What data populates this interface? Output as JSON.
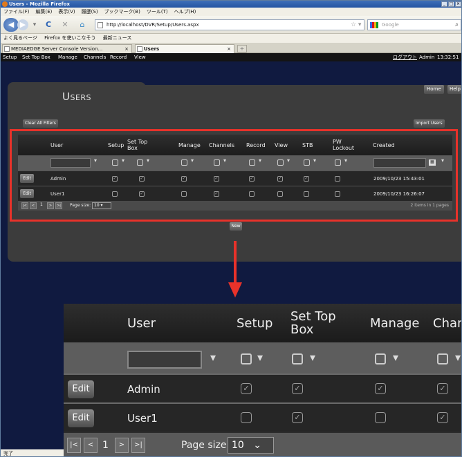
{
  "window": {
    "title": "Users - Mozilla Firefox",
    "controls": [
      "_",
      "□",
      "×"
    ]
  },
  "menu": [
    "ファイル(F)",
    "編集(E)",
    "表示(V)",
    "履歴(S)",
    "ブックマーク(B)",
    "ツール(T)",
    "ヘルプ(H)"
  ],
  "nav": {
    "url": "http://localhost/DVR/Setup/Users.aspx",
    "search_placeholder": "Google"
  },
  "bookmarks": [
    "よく見るページ",
    "Firefox を使いこなそう",
    "最新ニュース"
  ],
  "tabs": [
    {
      "label": "MEDIAEDGE Server Console Version..."
    },
    {
      "label": "Users"
    }
  ],
  "appnav": {
    "items": [
      "Setup",
      "Set Top Box",
      "Manage",
      "Channels",
      "Record",
      "View"
    ],
    "logout": "ログアウト",
    "user": "Admin",
    "time": "13:32:51"
  },
  "page": {
    "title": "Users",
    "home": "Home",
    "help": "Help",
    "clear_filters": "Clear All Filters",
    "import_users": "Import Users",
    "new": "New"
  },
  "grid": {
    "columns": [
      "User",
      "Setup",
      "Set Top Box",
      "Manage",
      "Channels",
      "Record",
      "View",
      "STB",
      "PW Lockout",
      "Created"
    ],
    "rows": [
      {
        "edit": "Edit",
        "user": "Admin",
        "created": "2009/10/23 15:43:01",
        "perms": [
          true,
          true,
          true,
          true,
          true,
          true,
          true,
          false
        ]
      },
      {
        "edit": "Edit",
        "user": "User1",
        "created": "2009/10/23 16:26:07",
        "perms": [
          false,
          true,
          false,
          true,
          false,
          false,
          false,
          false
        ]
      }
    ],
    "page_number": "1",
    "page_size_label": "Page size:",
    "page_size": "10",
    "items_summary": "2 items in 1 pages"
  },
  "status": "完了"
}
